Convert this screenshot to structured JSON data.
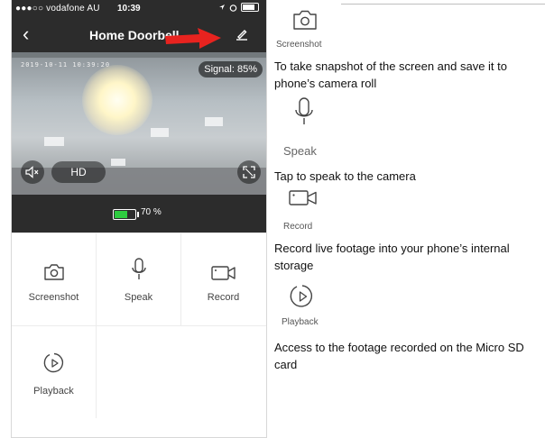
{
  "status_bar": {
    "carrier": "●●●○○ vodafone AU",
    "time": "10:39"
  },
  "header": {
    "back_glyph": "‹",
    "title": "Home Doorbell"
  },
  "video": {
    "osd_timestamp": "2019-10-11 10:39:20",
    "signal_label": "Signal: 85%",
    "quality_label": "HD"
  },
  "battery": {
    "percent_label": "70 %",
    "level": 0.7
  },
  "controls": [
    {
      "label": "Screenshot",
      "icon": "camera-icon"
    },
    {
      "label": "Speak",
      "icon": "microphone-icon"
    },
    {
      "label": "Record",
      "icon": "video-camera-icon"
    },
    {
      "label": "Playback",
      "icon": "playback-icon"
    }
  ],
  "legend": [
    {
      "caption": "Screenshot",
      "description": "To take snapshot of the screen and save it to phone’s camera roll",
      "icon": "camera-icon"
    },
    {
      "caption": "Speak",
      "description": "Tap to speak to the camera",
      "icon": "microphone-icon"
    },
    {
      "caption": "Record",
      "description": "Record live footage into your phone’s internal storage",
      "icon": "video-camera-icon"
    },
    {
      "caption": "Playback",
      "description": "Access to the footage recorded on the Micro SD card",
      "icon": "playback-icon"
    }
  ],
  "colors": {
    "bar": "#2c2c2c",
    "accent_red": "#e8231f",
    "battery_green": "#2ecc40"
  }
}
